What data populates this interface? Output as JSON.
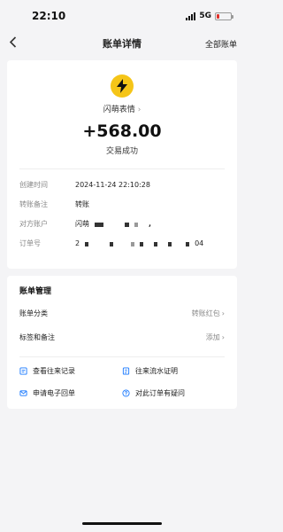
{
  "status_bar": {
    "time": "22:10",
    "network": "5G",
    "battery_level": 0.2,
    "battery_color": "#e0302a"
  },
  "nav": {
    "back_icon": "chevron-left-icon",
    "title": "账单详情",
    "right_link": "全部账单"
  },
  "transaction": {
    "merchant_icon": "lightning-icon",
    "merchant_icon_color": "#f5c518",
    "merchant_name": "闪萌表情",
    "amount": "+568.00",
    "status": "交易成功",
    "details": [
      {
        "label": "创建时间",
        "value": "2024-11-24 22:10:28"
      },
      {
        "label": "转账备注",
        "value": "转账"
      },
      {
        "label": "对方账户",
        "value": "闪萌"
      },
      {
        "label": "订单号",
        "value_prefix": "2",
        "value_suffix": "04"
      }
    ]
  },
  "management": {
    "title": "账单管理",
    "rows": [
      {
        "label": "账单分类",
        "value": "转账红包"
      },
      {
        "label": "标签和备注",
        "value": "添加"
      }
    ],
    "actions": [
      {
        "label": "查看往来记录",
        "icon": "records-icon"
      },
      {
        "label": "往来流水证明",
        "icon": "certificate-icon"
      },
      {
        "label": "申请电子回单",
        "icon": "mail-icon"
      },
      {
        "label": "对此订单有疑问",
        "icon": "question-icon"
      }
    ]
  },
  "accent_color": "#1677ff"
}
